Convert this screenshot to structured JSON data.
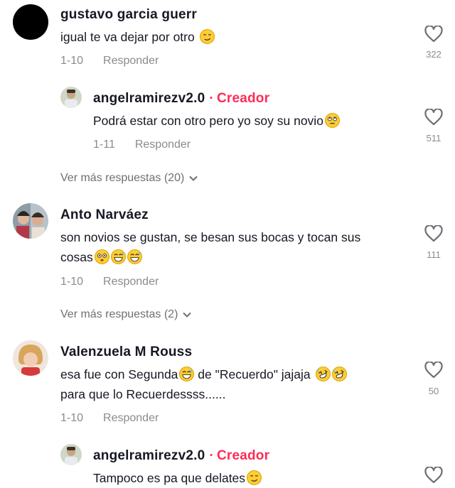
{
  "comments": [
    {
      "user": "gustavo garcia guerr",
      "text": "igual te va dejar por otro",
      "date": "1-10",
      "reply_label": "Responder",
      "likes": "322"
    },
    {
      "user": "angelramirezv2.0",
      "creator_label": "Creador",
      "text": "Podrá estar con otro pero yo soy su novio",
      "date": "1-11",
      "reply_label": "Responder",
      "likes": "511"
    },
    {
      "more_replies": "Ver más respuestas (20)"
    },
    {
      "user": "Anto Narváez",
      "text_line1": "son novios se gustan, se besan sus bocas y tocan sus",
      "text_line2": "cosas",
      "date": "1-10",
      "reply_label": "Responder",
      "likes": "111"
    },
    {
      "more_replies": "Ver más respuestas (2)"
    },
    {
      "user": "Valenzuela M Rouss",
      "text_line1a": "esa fue con Segunda",
      "text_line1b": "de \"Recuerdo\" jajaja",
      "text_line2": "para que lo Recuerdessss......",
      "date": "1-10",
      "reply_label": "Responder",
      "likes": "50"
    },
    {
      "user": "angelramirezv2.0",
      "creator_label": "Creador",
      "text": "Tampoco es pa que delates"
    }
  ],
  "colors": {
    "creator": "#fe2c55",
    "muted": "#8a8b91",
    "text": "#161823"
  },
  "icons": [
    "heart-icon",
    "chevron-down-icon",
    "emoji-smirk",
    "emoji-rolling-eyes",
    "emoji-grin-sweat",
    "emoji-rofl"
  ]
}
